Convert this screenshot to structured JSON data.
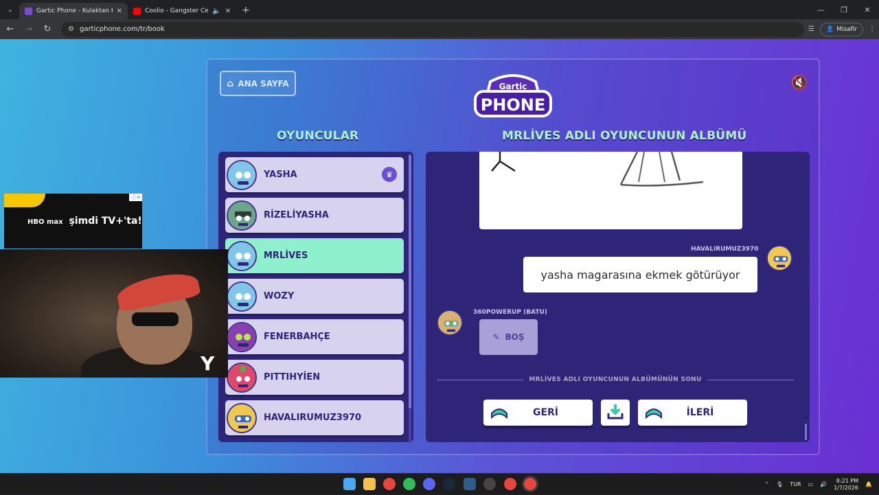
{
  "browser": {
    "tabs": [
      {
        "title": "Gartic Phone - Kulaktan Kulağa",
        "active": true,
        "favicon_color": "#7b4bd6"
      },
      {
        "title": "Coolio - Gangster Cenneti",
        "active": false,
        "favicon_color": "#ff0000"
      }
    ],
    "url": "garticphone.com/tr/book",
    "guest_label": "Misafir"
  },
  "page": {
    "home_label": "ANA SAYFA",
    "logo_top": "Gartic",
    "logo_bottom": "PHONE",
    "players_title": "OYUNCULAR",
    "album_title": "MRLİVES ADLI OYUNCUNUN ALBÜMÜ",
    "players": [
      {
        "name": "YASHA",
        "active": false,
        "host": true
      },
      {
        "name": "RİZELİYASHA",
        "active": false,
        "host": false
      },
      {
        "name": "MRLİVES",
        "active": true,
        "host": false
      },
      {
        "name": "WOZY",
        "active": false,
        "host": false
      },
      {
        "name": "FENERBAHÇE",
        "active": false,
        "host": false
      },
      {
        "name": "PITTIHYİEN",
        "active": false,
        "host": false
      },
      {
        "name": "HAVALIRUMUZ3970",
        "active": false,
        "host": false
      }
    ],
    "album": {
      "entry1_author": "HAVALIRUMUZ3970",
      "entry1_text": "yasha magarasına ekmek götürüyor",
      "entry2_author": "360POWERUP (BATU)",
      "entry2_empty": "BOŞ",
      "end_text": "MRLİVES ADLI OYUNCUNUN ALBÜMÜNÜN SONU",
      "back_label": "GERİ",
      "next_label": "İLERİ"
    }
  },
  "overlay": {
    "ad_text": "şimdi TV+'ta!",
    "ad_brand": "HBO max"
  },
  "taskbar": {
    "lang": "TUR",
    "time": "8:21 PM",
    "date": "1/7/2026"
  }
}
